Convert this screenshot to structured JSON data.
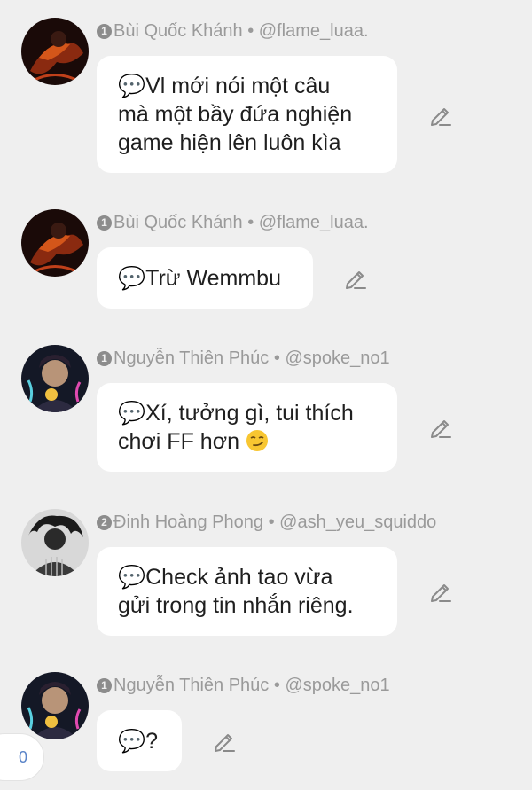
{
  "messages": [
    {
      "badge": "1",
      "author": "Bùi Quốc Khánh",
      "separator": "•",
      "handle": "@flame_luaa.",
      "text": "💬Vl mới nói một câu mà một bầy đứa nghiện game hiện lên luôn kìa",
      "lines": [
        "💬Vl mới nói một câu",
        "mà một bầy đứa nghiện",
        "game hiện lên luôn kìa"
      ]
    },
    {
      "badge": "1",
      "author": "Bùi Quốc Khánh",
      "separator": "•",
      "handle": "@flame_luaa.",
      "text": "💬Trừ Wemmbu",
      "lines": [
        "💬Trừ Wemmbu"
      ]
    },
    {
      "badge": "1",
      "author": "Nguyễn Thiên Phúc",
      "separator": "•",
      "handle": "@spoke_no1",
      "text": "💬Xí, tưởng gì, tui thích chơi FF hơn 😏",
      "lines": [
        "💬Xí, tưởng gì, tui thích",
        "chơi FF hơn"
      ]
    },
    {
      "badge": "2",
      "author": "Đinh Hoàng Phong",
      "separator": "•",
      "handle": "@ash_yeu_squiddo",
      "text": "💬Check ảnh tao vừa gửi trong tin nhắn riêng.",
      "lines": [
        "💬Check ảnh tao vừa",
        "gửi trong tin nhắn riêng."
      ]
    },
    {
      "badge": "1",
      "author": "Nguyễn Thiên Phúc",
      "separator": "•",
      "handle": "@spoke_no1",
      "text": "💬?",
      "lines": [
        "💬?"
      ]
    }
  ],
  "icons": {
    "edit": "pencil-icon",
    "emoji": "smirking-face-icon"
  },
  "counter": "0",
  "colors": {
    "background": "#efefef",
    "bubble": "#ffffff",
    "meta_text": "#9a9a9a",
    "counter_text": "#5a84c8"
  }
}
